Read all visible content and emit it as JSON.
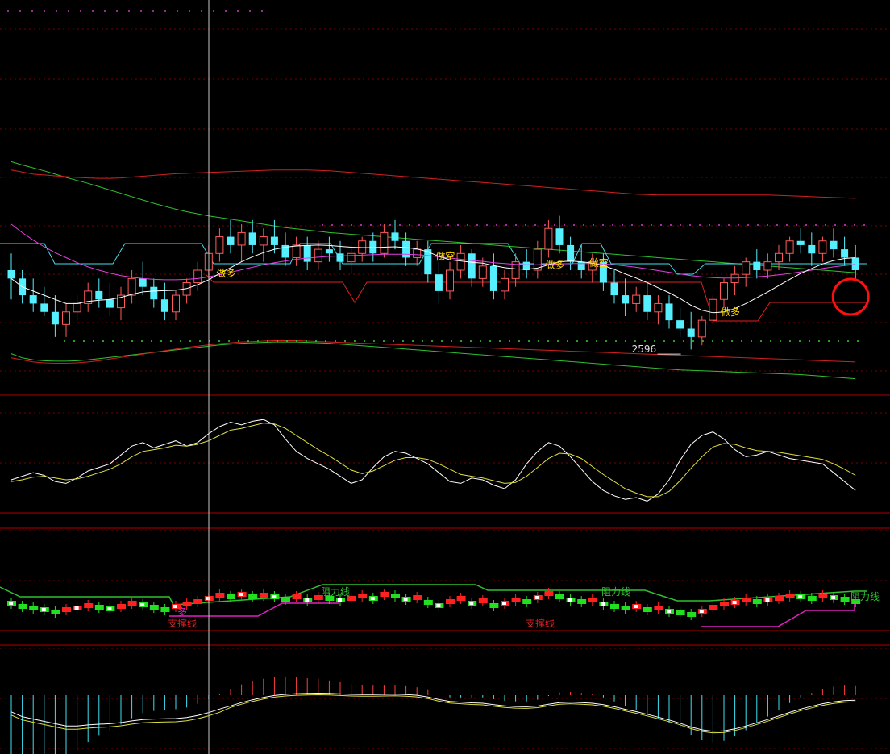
{
  "colors": {
    "background": "#000000",
    "grid": "#7a0000",
    "separator": "#b00000",
    "bull": "#ff5a5a",
    "bear": "#55f0ff",
    "ma_white": "#ffffff",
    "ma_magenta": "#e040e0",
    "ma_green": "#30c030",
    "ma_red": "#d02020",
    "stop_cyan": "#40e0f0",
    "stop_red": "#e02020",
    "label_yellow": "#ffd700",
    "kdj_white": "#ffffff",
    "kdj_yellow": "#e0e040",
    "support_magenta": "#e020c0",
    "resistance_green": "#30c030",
    "highlight_circle": "#ff1010"
  },
  "chart_data": [
    {
      "type": "candlestick",
      "panel": "main",
      "ohlc": [
        [
          2720,
          2760,
          2650,
          2700
        ],
        [
          2700,
          2720,
          2640,
          2660
        ],
        [
          2660,
          2700,
          2620,
          2640
        ],
        [
          2640,
          2680,
          2610,
          2620
        ],
        [
          2620,
          2660,
          2560,
          2590
        ],
        [
          2590,
          2640,
          2560,
          2620
        ],
        [
          2620,
          2660,
          2600,
          2640
        ],
        [
          2640,
          2690,
          2620,
          2670
        ],
        [
          2670,
          2700,
          2630,
          2650
        ],
        [
          2650,
          2690,
          2610,
          2630
        ],
        [
          2630,
          2680,
          2600,
          2660
        ],
        [
          2660,
          2720,
          2640,
          2700
        ],
        [
          2700,
          2740,
          2660,
          2680
        ],
        [
          2680,
          2700,
          2630,
          2650
        ],
        [
          2650,
          2690,
          2600,
          2620
        ],
        [
          2620,
          2670,
          2600,
          2660
        ],
        [
          2660,
          2700,
          2640,
          2690
        ],
        [
          2690,
          2740,
          2670,
          2720
        ],
        [
          2720,
          2780,
          2700,
          2760
        ],
        [
          2760,
          2820,
          2740,
          2800
        ],
        [
          2800,
          2840,
          2760,
          2780
        ],
        [
          2780,
          2830,
          2740,
          2810
        ],
        [
          2810,
          2840,
          2760,
          2780
        ],
        [
          2780,
          2820,
          2740,
          2800
        ],
        [
          2800,
          2840,
          2760,
          2780
        ],
        [
          2780,
          2810,
          2730,
          2750
        ],
        [
          2750,
          2800,
          2730,
          2780
        ],
        [
          2780,
          2800,
          2720,
          2740
        ],
        [
          2740,
          2790,
          2720,
          2770
        ],
        [
          2770,
          2800,
          2740,
          2760
        ],
        [
          2760,
          2790,
          2720,
          2740
        ],
        [
          2740,
          2780,
          2710,
          2760
        ],
        [
          2760,
          2800,
          2740,
          2790
        ],
        [
          2790,
          2810,
          2740,
          2760
        ],
        [
          2760,
          2830,
          2750,
          2810
        ],
        [
          2810,
          2840,
          2770,
          2790
        ],
        [
          2790,
          2810,
          2730,
          2750
        ],
        [
          2750,
          2790,
          2730,
          2770
        ],
        [
          2770,
          2790,
          2690,
          2710
        ],
        [
          2710,
          2740,
          2640,
          2670
        ],
        [
          2670,
          2740,
          2650,
          2720
        ],
        [
          2720,
          2780,
          2700,
          2760
        ],
        [
          2760,
          2770,
          2680,
          2700
        ],
        [
          2700,
          2750,
          2680,
          2730
        ],
        [
          2730,
          2760,
          2650,
          2670
        ],
        [
          2670,
          2720,
          2650,
          2700
        ],
        [
          2700,
          2760,
          2680,
          2740
        ],
        [
          2740,
          2770,
          2700,
          2720
        ],
        [
          2720,
          2790,
          2700,
          2770
        ],
        [
          2770,
          2840,
          2750,
          2820
        ],
        [
          2820,
          2850,
          2760,
          2780
        ],
        [
          2780,
          2800,
          2720,
          2740
        ],
        [
          2740,
          2780,
          2700,
          2720
        ],
        [
          2720,
          2760,
          2690,
          2740
        ],
        [
          2740,
          2760,
          2670,
          2690
        ],
        [
          2690,
          2720,
          2640,
          2660
        ],
        [
          2660,
          2700,
          2610,
          2640
        ],
        [
          2640,
          2680,
          2620,
          2660
        ],
        [
          2660,
          2690,
          2600,
          2620
        ],
        [
          2620,
          2660,
          2590,
          2640
        ],
        [
          2640,
          2660,
          2580,
          2600
        ],
        [
          2600,
          2630,
          2560,
          2580
        ],
        [
          2580,
          2620,
          2530,
          2560
        ],
        [
          2560,
          2610,
          2540,
          2600
        ],
        [
          2600,
          2660,
          2590,
          2650
        ],
        [
          2650,
          2700,
          2630,
          2690
        ],
        [
          2690,
          2730,
          2660,
          2710
        ],
        [
          2710,
          2750,
          2680,
          2740
        ],
        [
          2740,
          2770,
          2700,
          2720
        ],
        [
          2720,
          2760,
          2700,
          2740
        ],
        [
          2740,
          2780,
          2720,
          2760
        ],
        [
          2760,
          2800,
          2740,
          2790
        ],
        [
          2790,
          2820,
          2760,
          2780
        ],
        [
          2780,
          2810,
          2730,
          2760
        ],
        [
          2760,
          2800,
          2740,
          2790
        ],
        [
          2790,
          2820,
          2750,
          2770
        ],
        [
          2770,
          2800,
          2730,
          2750
        ],
        [
          2750,
          2780,
          2700,
          2720
        ]
      ],
      "ma_white": [
        2700,
        2680,
        2670,
        2660,
        2650,
        2640,
        2640,
        2645,
        2648,
        2650,
        2655,
        2662,
        2668,
        2670,
        2671,
        2672,
        2676,
        2685,
        2697,
        2712,
        2726,
        2740,
        2752,
        2762,
        2770,
        2775,
        2778,
        2779,
        2780,
        2779,
        2777,
        2775,
        2774,
        2774,
        2775,
        2776,
        2774,
        2771,
        2764,
        2753,
        2745,
        2742,
        2739,
        2737,
        2731,
        2726,
        2723,
        2722,
        2725,
        2733,
        2740,
        2742,
        2740,
        2737,
        2731,
        2722,
        2711,
        2701,
        2690,
        2678,
        2666,
        2652,
        2636,
        2624,
        2618,
        2620,
        2628,
        2640,
        2654,
        2668,
        2683,
        2698,
        2712,
        2724,
        2735,
        2743,
        2748,
        2750
      ],
      "ma_magenta": [
        2830,
        2810,
        2792,
        2776,
        2762,
        2750,
        2738,
        2728,
        2720,
        2713,
        2707,
        2703,
        2700,
        2698,
        2697,
        2697,
        2698,
        2700,
        2704,
        2709,
        2715,
        2721,
        2727,
        2733,
        2738,
        2742,
        2746,
        2749,
        2751,
        2753,
        2754,
        2755,
        2756,
        2757,
        2758,
        2758,
        2758,
        2757,
        2755,
        2752,
        2749,
        2746,
        2743,
        2741,
        2738,
        2736,
        2734,
        2733,
        2733,
        2734,
        2735,
        2736,
        2736,
        2736,
        2735,
        2733,
        2730,
        2727,
        2723,
        2719,
        2715,
        2711,
        2707,
        2704,
        2702,
        2701,
        2701,
        2702,
        2704,
        2706,
        2709,
        2712,
        2716,
        2720,
        2724,
        2728,
        2731,
        2734
      ],
      "ma_green_upper": [
        2980,
        2972,
        2965,
        2958,
        2950,
        2942,
        2935,
        2928,
        2920,
        2912,
        2904,
        2896,
        2888,
        2880,
        2873,
        2866,
        2860,
        2855,
        2850,
        2846,
        2842,
        2838,
        2834,
        2830,
        2826,
        2822,
        2819,
        2816,
        2813,
        2810,
        2808,
        2806,
        2804,
        2802,
        2800,
        2798,
        2796,
        2794,
        2792,
        2790,
        2788,
        2786,
        2784,
        2782,
        2780,
        2778,
        2776,
        2774,
        2772,
        2770,
        2768,
        2766,
        2764,
        2762,
        2760,
        2758,
        2756,
        2754,
        2752,
        2750,
        2748,
        2746,
        2744,
        2742,
        2740,
        2738,
        2736,
        2734,
        2732,
        2730,
        2728,
        2726,
        2724,
        2722,
        2720,
        2718,
        2716,
        2714
      ],
      "ma_red_upper": [
        2960,
        2955,
        2950,
        2948,
        2946,
        2944,
        2942,
        2941,
        2940,
        2940,
        2941,
        2943,
        2945,
        2947,
        2949,
        2951,
        2952,
        2953,
        2954,
        2955,
        2956,
        2957,
        2958,
        2959,
        2960,
        2960,
        2960,
        2960,
        2959,
        2958,
        2956,
        2954,
        2952,
        2950,
        2948,
        2946,
        2944,
        2942,
        2940,
        2938,
        2936,
        2934,
        2932,
        2930,
        2928,
        2926,
        2924,
        2922,
        2920,
        2918,
        2916,
        2914,
        2912,
        2910,
        2908,
        2906,
        2904,
        2902,
        2901,
        2900,
        2900,
        2900,
        2900,
        2900,
        2900,
        2900,
        2900,
        2900,
        2900,
        2900,
        2899,
        2898,
        2897,
        2896,
        2895,
        2894,
        2893,
        2892
      ],
      "ma_green_lower": [
        2520,
        2510,
        2505,
        2503,
        2502,
        2502,
        2503,
        2505,
        2508,
        2511,
        2514,
        2517,
        2520,
        2523,
        2526,
        2529,
        2532,
        2535,
        2538,
        2541,
        2543,
        2545,
        2546,
        2547,
        2548,
        2548,
        2548,
        2547,
        2546,
        2545,
        2543,
        2541,
        2539,
        2537,
        2535,
        2533,
        2531,
        2529,
        2527,
        2525,
        2523,
        2521,
        2519,
        2517,
        2515,
        2513,
        2511,
        2509,
        2507,
        2505,
        2503,
        2501,
        2499,
        2497,
        2495,
        2493,
        2491,
        2489,
        2487,
        2485,
        2483,
        2481,
        2480,
        2479,
        2478,
        2477,
        2476,
        2475,
        2474,
        2473,
        2472,
        2471,
        2470,
        2468,
        2466,
        2464,
        2462,
        2460
      ],
      "ma_red_lower": [
        2510,
        2505,
        2500,
        2498,
        2497,
        2497,
        2498,
        2500,
        2503,
        2507,
        2511,
        2515,
        2519,
        2523,
        2527,
        2531,
        2535,
        2538,
        2541,
        2544,
        2546,
        2548,
        2549,
        2550,
        2551,
        2551,
        2551,
        2550,
        2549,
        2548,
        2547,
        2546,
        2545,
        2544,
        2543,
        2542,
        2541,
        2540,
        2539,
        2538,
        2537,
        2536,
        2535,
        2534,
        2533,
        2532,
        2531,
        2530,
        2529,
        2528,
        2527,
        2526,
        2525,
        2524,
        2523,
        2522,
        2521,
        2520,
        2519,
        2518,
        2517,
        2516,
        2515,
        2514,
        2513,
        2512,
        2511,
        2510,
        2509,
        2508,
        2507,
        2506,
        2505,
        2504,
        2503,
        2502,
        2501,
        2500
      ],
      "signals": [
        {
          "index": 19,
          "text": "做多"
        },
        {
          "index": 39,
          "text": "做空"
        },
        {
          "index": 49,
          "text": "做多"
        },
        {
          "index": 53,
          "text": "做空"
        },
        {
          "index": 65,
          "text": "做多"
        }
      ],
      "annotations": [
        {
          "text": "2596"
        }
      ],
      "highlight_index": 77
    },
    {
      "type": "line",
      "panel": "kdj",
      "series": [
        {
          "color": "white",
          "values": [
            30,
            34,
            38,
            35,
            28,
            26,
            32,
            40,
            44,
            48,
            58,
            68,
            72,
            66,
            70,
            74,
            68,
            72,
            82,
            90,
            95,
            92,
            96,
            98,
            92,
            76,
            62,
            54,
            48,
            42,
            34,
            26,
            30,
            44,
            56,
            62,
            60,
            54,
            48,
            38,
            28,
            26,
            32,
            30,
            24,
            20,
            30,
            48,
            62,
            72,
            68,
            56,
            42,
            28,
            18,
            12,
            8,
            10,
            6,
            14,
            30,
            52,
            70,
            80,
            84,
            76,
            64,
            56,
            58,
            62,
            58,
            54,
            52,
            50,
            48,
            38,
            28,
            18
          ]
        },
        {
          "color": "yellow",
          "values": [
            28,
            30,
            33,
            34,
            32,
            30,
            31,
            34,
            38,
            42,
            48,
            56,
            62,
            64,
            66,
            69,
            68,
            70,
            74,
            80,
            86,
            88,
            91,
            94,
            93,
            88,
            80,
            72,
            64,
            57,
            49,
            41,
            37,
            40,
            46,
            52,
            55,
            55,
            53,
            48,
            42,
            36,
            34,
            32,
            29,
            26,
            27,
            34,
            44,
            54,
            60,
            59,
            54,
            45,
            36,
            28,
            20,
            15,
            11,
            11,
            17,
            29,
            43,
            56,
            67,
            71,
            70,
            66,
            63,
            62,
            61,
            59,
            57,
            55,
            53,
            48,
            42,
            35
          ]
        }
      ]
    },
    {
      "type": "candlestick",
      "panel": "support_resistance",
      "labels": {
        "support": "支撑线",
        "resistance": "阻力线",
        "long": "多"
      }
    },
    {
      "type": "bar",
      "panel": "macd"
    }
  ]
}
